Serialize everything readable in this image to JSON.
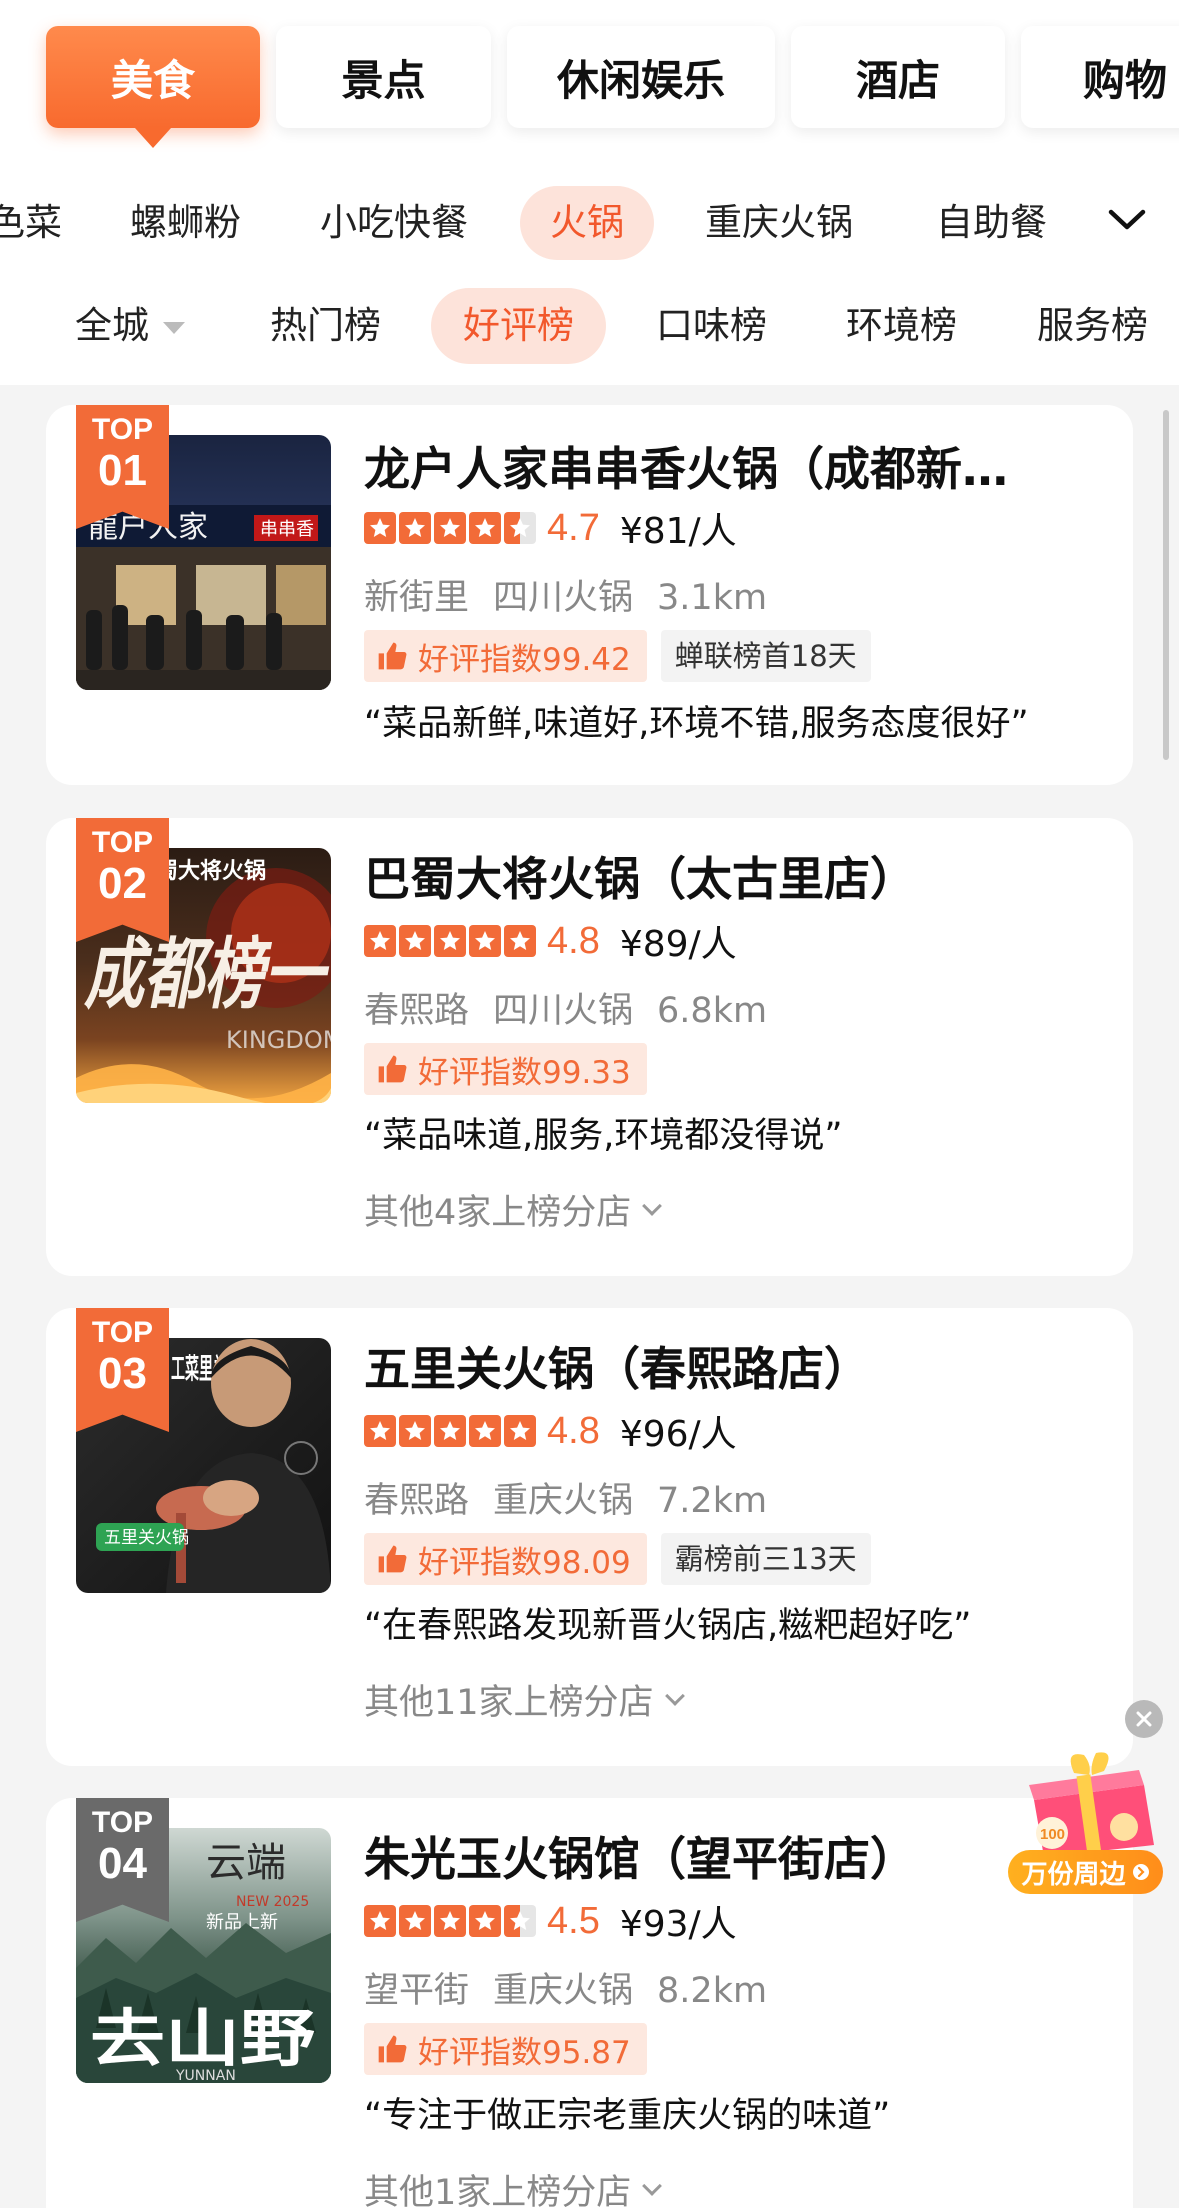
{
  "category_tabs": [
    "美食",
    "景点",
    "休闲娱乐",
    "酒店",
    "购物"
  ],
  "sub_tabs": [
    "色菜",
    "螺蛳粉",
    "小吃快餐",
    "火锅",
    "重庆火锅",
    "自助餐"
  ],
  "rank_tabs": {
    "city": "全城",
    "items": [
      "热门榜",
      "好评榜",
      "口味榜",
      "环境榜",
      "服务榜"
    ]
  },
  "colors": {
    "accent": "#f26b38",
    "accent_light": "#fde3da",
    "tab_gradient_start": "#ff8a4c",
    "tab_gradient_end": "#f86a2e"
  },
  "restaurants": [
    {
      "badge_top": "TOP",
      "badge_num": "01",
      "name": "龙户人家串串香火锅（成都新…",
      "stars": 4.5,
      "score": "4.7",
      "price": "¥81/人",
      "area": "新街里",
      "cuisine": "四川火锅",
      "distance": "3.1km",
      "praise": "好评指数99.42",
      "rank_tag": "蝉联榜首18天",
      "quote": "“菜品新鲜,味道好,环境不错,服务态度很好”",
      "branches": ""
    },
    {
      "badge_top": "TOP",
      "badge_num": "02",
      "name": "巴蜀大将火锅（太古里店）",
      "stars": 5,
      "score": "4.8",
      "price": "¥89/人",
      "area": "春熙路",
      "cuisine": "四川火锅",
      "distance": "6.8km",
      "praise": "好评指数99.33",
      "rank_tag": "",
      "quote": "“菜品味道,服务,环境都没得说”",
      "branches": "其他4家上榜分店"
    },
    {
      "badge_top": "TOP",
      "badge_num": "03",
      "name": "五里关火锅（春熙路店）",
      "stars": 5,
      "score": "4.8",
      "price": "¥96/人",
      "area": "春熙路",
      "cuisine": "重庆火锅",
      "distance": "7.2km",
      "praise": "好评指数98.09",
      "rank_tag": "霸榜前三13天",
      "quote": "“在春熙路发现新晋火锅店,糍粑超好吃”",
      "branches": "其他11家上榜分店"
    },
    {
      "badge_top": "TOP",
      "badge_num": "04",
      "name": "朱光玉火锅馆（望平街店）",
      "stars": 4.5,
      "score": "4.5",
      "price": "¥93/人",
      "area": "望平街",
      "cuisine": "重庆火锅",
      "distance": "8.2km",
      "praise": "好评指数95.87",
      "rank_tag": "",
      "quote": "“专注于做正宗老重庆火锅的味道”",
      "branches": "其他1家上榜分店"
    }
  ],
  "thumb_texts": {
    "r1_sign": "龍户人家",
    "r1_sign2": "串串香",
    "r2_brand": "蜀大将火锅",
    "r2_big": "成都榜一",
    "r2_eng": "KINGDOM",
    "r3_side": "工菜里关",
    "r3_badge": "五里关火锅",
    "r4_top": "云端",
    "r4_sub": "新品上新",
    "r4_year": "NEW 2025",
    "r4_big": "去山野",
    "r4_eng": "YUNNAN"
  },
  "float_widget": {
    "label": "万份周边",
    "badge": "100"
  }
}
